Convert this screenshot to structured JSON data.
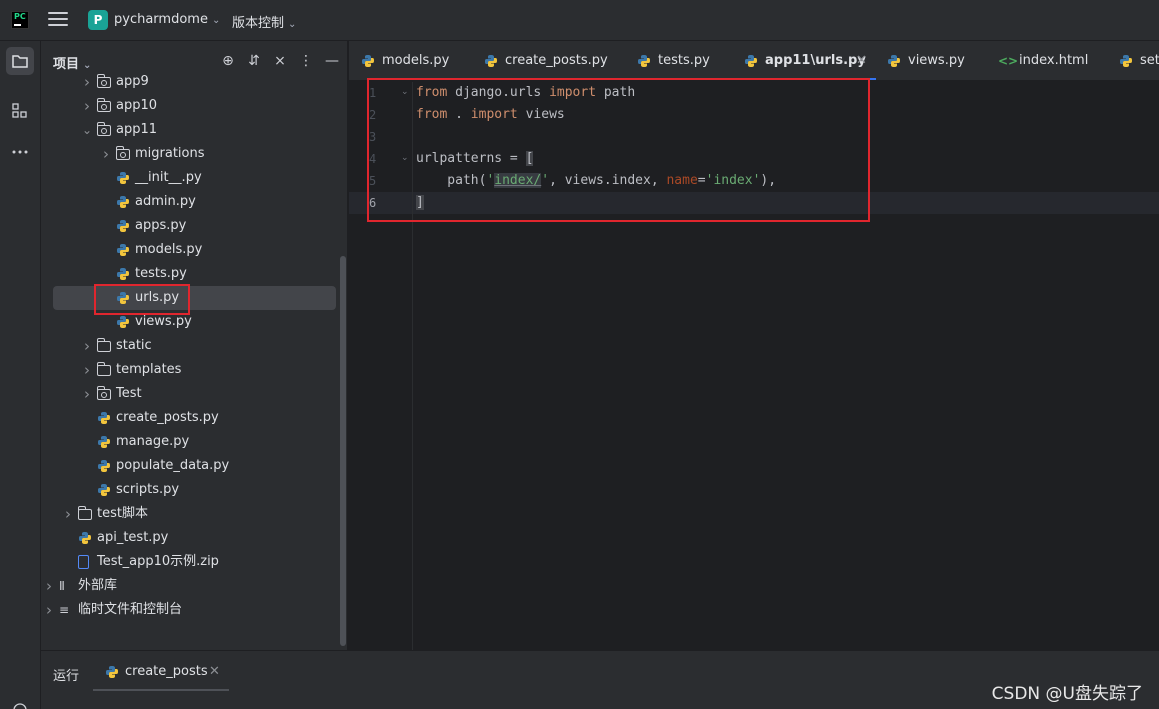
{
  "titlebar": {
    "project_initial": "P",
    "project_name": "pycharmdome",
    "vcs_label": "版本控制"
  },
  "panel": {
    "title": "项目",
    "tools": [
      "crosshair-icon",
      "expand-icon",
      "collapse-icon",
      "more-icon",
      "minimize-icon"
    ]
  },
  "tree": [
    {
      "label": "app9",
      "type": "package",
      "expand": "collapsed",
      "depth": 2
    },
    {
      "label": "app10",
      "type": "package",
      "expand": "collapsed",
      "depth": 2
    },
    {
      "label": "app11",
      "type": "package",
      "expand": "expanded",
      "depth": 2
    },
    {
      "label": "migrations",
      "type": "package",
      "expand": "collapsed",
      "depth": 3
    },
    {
      "label": "__init__.py",
      "type": "python",
      "depth": 3
    },
    {
      "label": "admin.py",
      "type": "python",
      "depth": 3
    },
    {
      "label": "apps.py",
      "type": "python",
      "depth": 3
    },
    {
      "label": "models.py",
      "type": "python",
      "depth": 3
    },
    {
      "label": "tests.py",
      "type": "python",
      "depth": 3
    },
    {
      "label": "urls.py",
      "type": "python",
      "depth": 3,
      "selected": true
    },
    {
      "label": "views.py",
      "type": "python",
      "depth": 3
    },
    {
      "label": "static",
      "type": "folder",
      "expand": "collapsed",
      "depth": 2
    },
    {
      "label": "templates",
      "type": "folder",
      "expand": "collapsed",
      "depth": 2
    },
    {
      "label": "Test",
      "type": "package",
      "expand": "collapsed",
      "depth": 2
    },
    {
      "label": "create_posts.py",
      "type": "python",
      "depth": 2
    },
    {
      "label": "manage.py",
      "type": "python",
      "depth": 2
    },
    {
      "label": "populate_data.py",
      "type": "python",
      "depth": 2
    },
    {
      "label": "scripts.py",
      "type": "python",
      "depth": 2
    },
    {
      "label": "test脚本",
      "type": "folder",
      "expand": "collapsed",
      "depth": 1
    },
    {
      "label": "api_test.py",
      "type": "python",
      "depth": 1
    },
    {
      "label": "Test_app10示例.zip",
      "type": "zip",
      "depth": 1
    },
    {
      "label": "外部库",
      "type": "library",
      "expand": "collapsed",
      "depth": 0
    },
    {
      "label": "临时文件和控制台",
      "type": "scratches",
      "expand": "collapsed",
      "depth": 0
    }
  ],
  "tabs": [
    {
      "label": "models.py",
      "icon": "python-icon"
    },
    {
      "label": "create_posts.py",
      "icon": "python-icon"
    },
    {
      "label": "tests.py",
      "icon": "python-icon"
    },
    {
      "label": "app11\\urls.py",
      "icon": "python-icon",
      "active": true
    },
    {
      "label": "views.py",
      "icon": "python-icon"
    },
    {
      "label": "index.html",
      "icon": "html-icon"
    },
    {
      "label": "set",
      "icon": "python-icon"
    }
  ],
  "editor": {
    "line_numbers": [
      "1",
      "2",
      "3",
      "4",
      "5",
      "6"
    ],
    "current_line": "6",
    "lines": {
      "l1": {
        "kw1": "from",
        "mod": " django.urls ",
        "kw2": "import",
        "rest": " path"
      },
      "l2": {
        "kw1": "from",
        "mod": " . ",
        "kw2": "import",
        "rest": " views"
      },
      "l4": {
        "a": "urlpatterns = ",
        "b": "["
      },
      "l5": {
        "indent": "    path(",
        "s1": "'",
        "hl": "index/",
        "s2": "'",
        "mid": ", views.index, ",
        "param": "name",
        "eq": "=",
        "s3": "'index'",
        "end": "),"
      },
      "l6": {
        "b": "]"
      }
    }
  },
  "run": {
    "title": "运行",
    "tab_label": "create_posts"
  },
  "watermark": "CSDN @U盘失踪了"
}
